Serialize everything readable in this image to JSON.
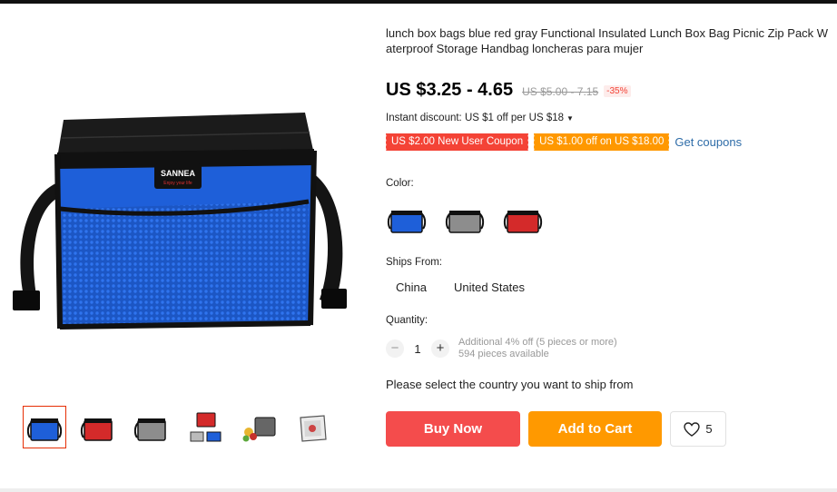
{
  "product": {
    "title": "lunch box bags blue red gray Functional Insulated Lunch Box Bag Picnic Zip Pack Waterproof Storage Handbag loncheras para mujer",
    "brand_tag": "SANNEA",
    "brand_slogan": "Enjoy your life"
  },
  "pricing": {
    "price": "US $3.25 - 4.65",
    "original_price": "US $5.00 - 7.15",
    "discount": "-35%",
    "instant_discount": "Instant discount: US $1 off per US $18"
  },
  "coupons": {
    "new_user": "US $2.00 New User Coupon",
    "store": "US $1.00 off on US $18.00",
    "get_link": "Get coupons"
  },
  "color": {
    "label": "Color:",
    "options": [
      "blue",
      "gray",
      "red"
    ]
  },
  "ships_from": {
    "label": "Ships From:",
    "options": [
      "China",
      "United States"
    ]
  },
  "quantity": {
    "label": "Quantity:",
    "value": "1",
    "minus": "−",
    "plus": "+",
    "note": "Additional 4% off (5 pieces or more)",
    "available": "594 pieces available"
  },
  "notice": "Please select the country you want to ship from",
  "actions": {
    "buy_now": "Buy Now",
    "add_to_cart": "Add to Cart",
    "wishlist_count": "5"
  },
  "thumbnails": [
    "blue bag",
    "red bag",
    "gray bag",
    "red and blue bag set",
    "gray bag with food",
    "clear bag"
  ],
  "colors": {
    "blue": "#1e5fd9",
    "red": "#d42a2a",
    "gray": "#8d8d8d",
    "buy_button": "#f44c4c",
    "cart_button": "#ff9900",
    "coupon_red": "#f44336",
    "coupon_orange": "#ff9800",
    "link": "#2e6ca8"
  }
}
